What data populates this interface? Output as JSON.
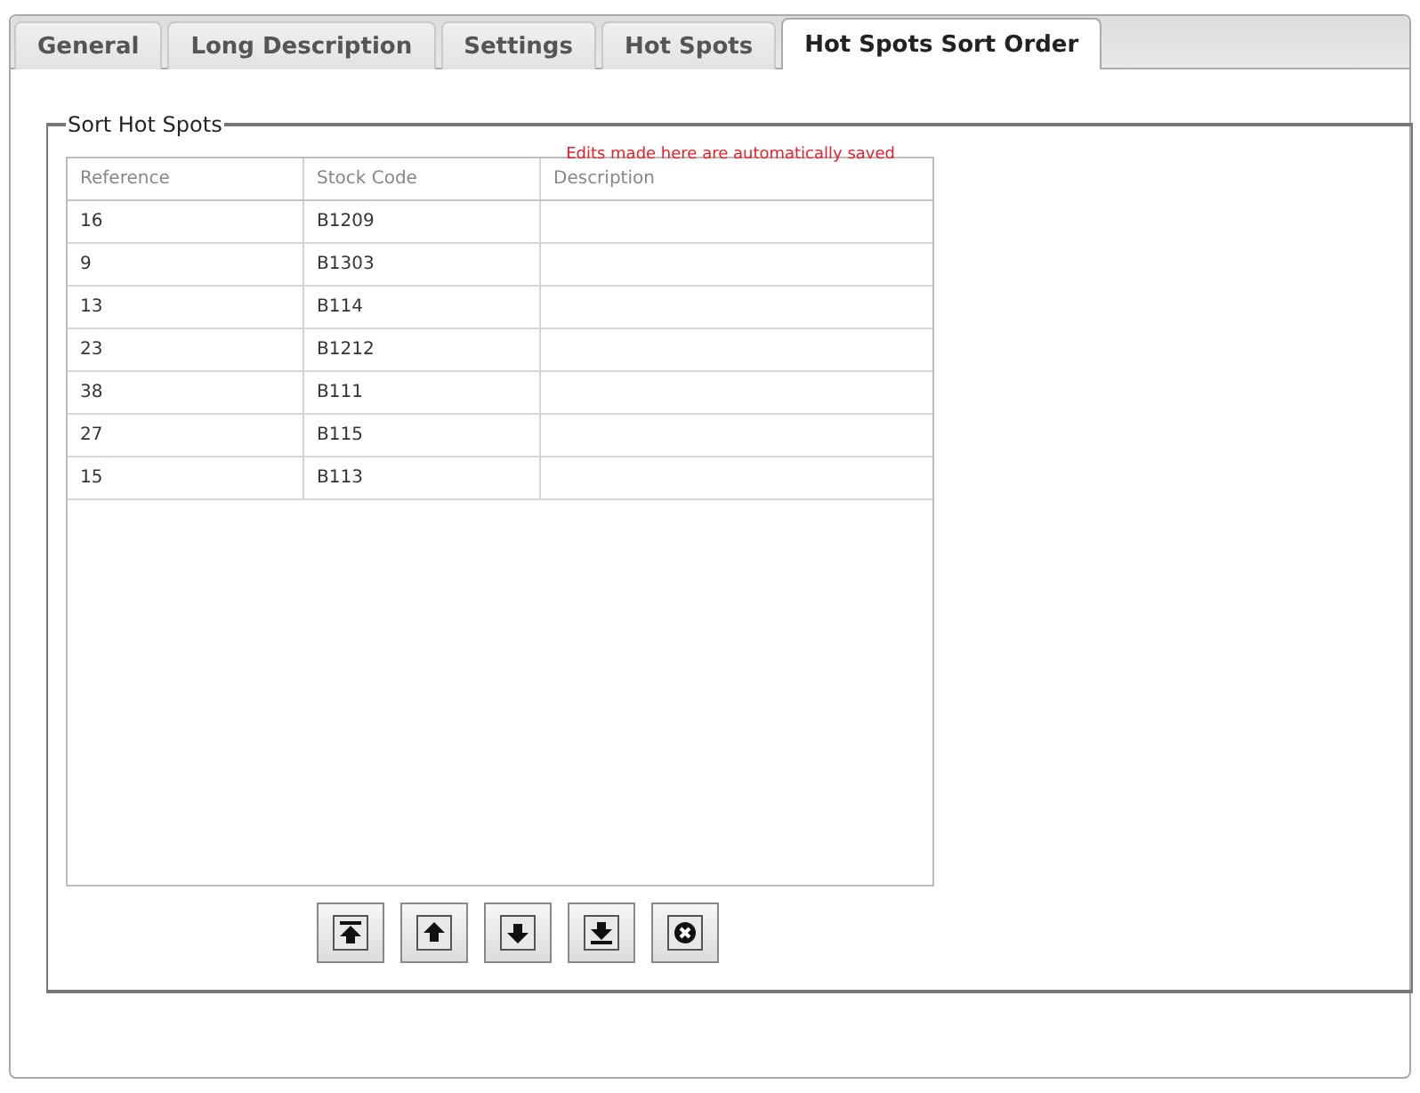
{
  "tabs": [
    {
      "label": "General",
      "selected": false
    },
    {
      "label": "Long Description",
      "selected": false
    },
    {
      "label": "Settings",
      "selected": false
    },
    {
      "label": "Hot Spots",
      "selected": false
    },
    {
      "label": "Hot Spots Sort Order",
      "selected": true
    }
  ],
  "group": {
    "legend": "Sort Hot Spots",
    "notice": "Edits made here are automatically saved"
  },
  "table": {
    "columns": [
      "Reference",
      "Stock Code",
      "Description"
    ],
    "rows": [
      [
        "16",
        "B1209"
      ],
      [
        "9",
        "B1303"
      ],
      [
        "13",
        "B114"
      ],
      [
        "23",
        "B1212"
      ],
      [
        "38",
        "B111"
      ],
      [
        "27",
        "B115"
      ],
      [
        "15",
        "B113"
      ]
    ]
  },
  "buttons": [
    {
      "kind": "top"
    },
    {
      "kind": "up"
    },
    {
      "kind": "down"
    },
    {
      "kind": "bottom"
    },
    {
      "kind": "remove"
    }
  ]
}
